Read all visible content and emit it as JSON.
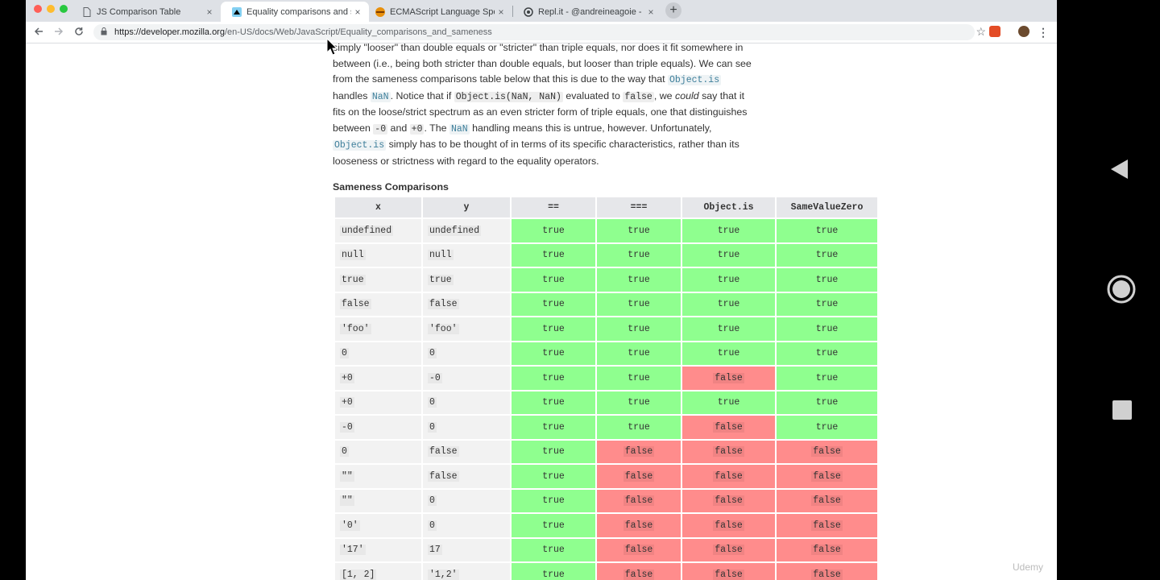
{
  "browser": {
    "tabs": [
      {
        "title": "JS Comparison Table",
        "active": false
      },
      {
        "title": "Equality comparisons and sam",
        "active": true
      },
      {
        "title": "ECMAScript Language Specific",
        "active": false
      },
      {
        "title": "Repl.it - @andreineagoie - zer",
        "active": false
      }
    ],
    "url_host": "https://developer.mozilla.org",
    "url_path": "/en-US/docs/Web/JavaScript/Equality_comparisons_and_sameness",
    "close_glyph": "×",
    "new_tab_glyph": "+"
  },
  "prose": {
    "l1": "simply \"looser\" than double equals or \"stricter\" than triple equals, nor does it fit somewhere in",
    "l2": "between (i.e., being both stricter than double equals, but looser than triple equals). We can see",
    "l3a": "from the sameness comparisons table below that this is due to the way that ",
    "code_object_is": "Object.is",
    "l4a": "handles ",
    "code_nan": "NaN",
    "l4b": ". Notice that if ",
    "code_is_nan": "Object.is(NaN, NaN)",
    "l4c": " evaluated to ",
    "code_false": "false",
    "l4d": ", we ",
    "could": "could",
    "l4e": " say that it",
    "l5": "fits on the loose/strict spectrum as an even stricter form of triple equals, one that distinguishes",
    "l6a": "between ",
    "code_neg0": "-0",
    "l6b": " and ",
    "code_pos0": "+0",
    "l6c": ". The ",
    "l6d": " handling means this is untrue, however. Unfortunately,",
    "l7b": " simply has to be thought of in terms of its specific characteristics, rather than its",
    "l8": "looseness or strictness with regard to the equality operators."
  },
  "table": {
    "title": "Sameness Comparisons",
    "headers": [
      "x",
      "y",
      "==",
      "===",
      "Object.is",
      "SameValueZero"
    ],
    "rows": [
      [
        "undefined",
        "undefined",
        "true",
        "true",
        "true",
        "true"
      ],
      [
        "null",
        "null",
        "true",
        "true",
        "true",
        "true"
      ],
      [
        "true",
        "true",
        "true",
        "true",
        "true",
        "true"
      ],
      [
        "false",
        "false",
        "true",
        "true",
        "true",
        "true"
      ],
      [
        "'foo'",
        "'foo'",
        "true",
        "true",
        "true",
        "true"
      ],
      [
        "0",
        "0",
        "true",
        "true",
        "true",
        "true"
      ],
      [
        "+0",
        "-0",
        "true",
        "true",
        "false",
        "true"
      ],
      [
        "+0",
        "0",
        "true",
        "true",
        "true",
        "true"
      ],
      [
        "-0",
        "0",
        "true",
        "true",
        "false",
        "true"
      ],
      [
        "0",
        "false",
        "true",
        "false",
        "false",
        "false"
      ],
      [
        "\"\"",
        "false",
        "true",
        "false",
        "false",
        "false"
      ],
      [
        "\"\"",
        "0",
        "true",
        "false",
        "false",
        "false"
      ],
      [
        "'0'",
        "0",
        "true",
        "false",
        "false",
        "false"
      ],
      [
        "'17'",
        "17",
        "true",
        "false",
        "false",
        "false"
      ],
      [
        "[1, 2]",
        "'1,2'",
        "true",
        "false",
        "false",
        "false"
      ]
    ]
  },
  "colors": {
    "true_cell": "#8fff8f",
    "false_cell": "#ff8c8c",
    "link_code": "#3d7e9a"
  },
  "player": {
    "watermark": "Udemy"
  }
}
